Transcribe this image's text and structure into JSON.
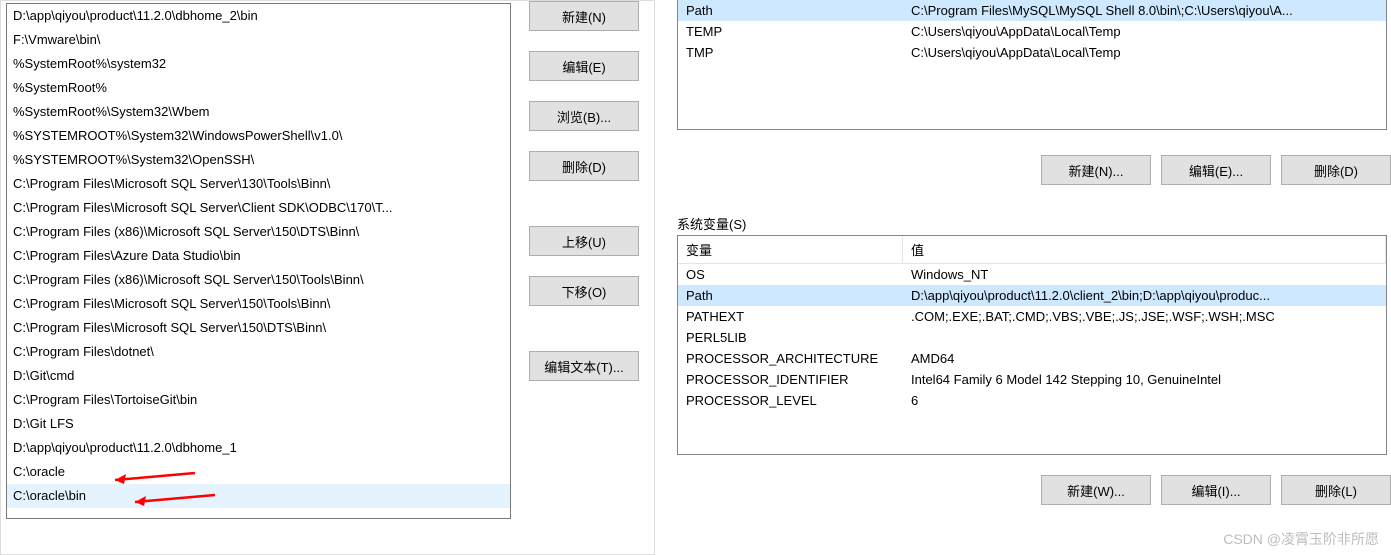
{
  "left": {
    "paths": [
      "D:\\app\\qiyou\\product\\11.2.0\\dbhome_2\\bin",
      "F:\\Vmware\\bin\\",
      "%SystemRoot%\\system32",
      "%SystemRoot%",
      "%SystemRoot%\\System32\\Wbem",
      "%SYSTEMROOT%\\System32\\WindowsPowerShell\\v1.0\\",
      "%SYSTEMROOT%\\System32\\OpenSSH\\",
      "C:\\Program Files\\Microsoft SQL Server\\130\\Tools\\Binn\\",
      "C:\\Program Files\\Microsoft SQL Server\\Client SDK\\ODBC\\170\\T...",
      "C:\\Program Files (x86)\\Microsoft SQL Server\\150\\DTS\\Binn\\",
      "C:\\Program Files\\Azure Data Studio\\bin",
      "C:\\Program Files (x86)\\Microsoft SQL Server\\150\\Tools\\Binn\\",
      "C:\\Program Files\\Microsoft SQL Server\\150\\Tools\\Binn\\",
      "C:\\Program Files\\Microsoft SQL Server\\150\\DTS\\Binn\\",
      "C:\\Program Files\\dotnet\\",
      "D:\\Git\\cmd",
      "C:\\Program Files\\TortoiseGit\\bin",
      "D:\\Git LFS",
      "D:\\app\\qiyou\\product\\11.2.0\\dbhome_1",
      "C:\\oracle",
      "C:\\oracle\\bin"
    ],
    "selected_index": 20,
    "buttons": {
      "new": "新建(N)",
      "edit": "编辑(E)",
      "browse": "浏览(B)...",
      "delete": "删除(D)",
      "move_up": "上移(U)",
      "move_down": "下移(O)",
      "edit_text": "编辑文本(T)..."
    }
  },
  "right": {
    "user_vars": [
      {
        "name": "Path",
        "value": "C:\\Program Files\\MySQL\\MySQL Shell 8.0\\bin\\;C:\\Users\\qiyou\\A..."
      },
      {
        "name": "TEMP",
        "value": "C:\\Users\\qiyou\\AppData\\Local\\Temp"
      },
      {
        "name": "TMP",
        "value": "C:\\Users\\qiyou\\AppData\\Local\\Temp"
      }
    ],
    "user_selected_index": 0,
    "user_buttons": {
      "new": "新建(N)...",
      "edit": "编辑(E)...",
      "delete": "删除(D)"
    },
    "system_label": "系统变量(S)",
    "system_headers": {
      "name": "变量",
      "value": "值"
    },
    "system_vars": [
      {
        "name": "OS",
        "value": "Windows_NT"
      },
      {
        "name": "Path",
        "value": "D:\\app\\qiyou\\product\\11.2.0\\client_2\\bin;D:\\app\\qiyou\\produc..."
      },
      {
        "name": "PATHEXT",
        "value": ".COM;.EXE;.BAT;.CMD;.VBS;.VBE;.JS;.JSE;.WSF;.WSH;.MSC"
      },
      {
        "name": "PERL5LIB",
        "value": ""
      },
      {
        "name": "PROCESSOR_ARCHITECTURE",
        "value": "AMD64"
      },
      {
        "name": "PROCESSOR_IDENTIFIER",
        "value": "Intel64 Family 6 Model 142 Stepping 10, GenuineIntel"
      },
      {
        "name": "PROCESSOR_LEVEL",
        "value": "6"
      }
    ],
    "system_selected_index": 1,
    "system_buttons": {
      "new": "新建(W)...",
      "edit": "编辑(I)...",
      "delete": "删除(L)"
    }
  },
  "watermark": "CSDN @凌霄玉阶非所愿",
  "annotations": {
    "arrow_color": "#ff0000"
  }
}
